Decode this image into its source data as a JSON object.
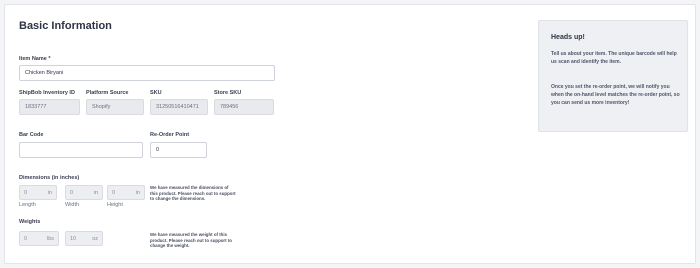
{
  "section_title": "Basic Information",
  "item_name": {
    "label": "Item Name *",
    "value": "Chicken Biryani"
  },
  "shipbob_id": {
    "label": "ShipBob Inventory ID",
    "value": "1833777"
  },
  "platform_source": {
    "label": "Platform Source",
    "value": "Shopify"
  },
  "sku": {
    "label": "SKU",
    "value": "31250516410471"
  },
  "store_sku": {
    "label": "Store SKU",
    "value": "789456"
  },
  "bar_code": {
    "label": "Bar Code",
    "value": ""
  },
  "reorder_point": {
    "label": "Re-Order Point",
    "value": "0"
  },
  "dimensions": {
    "label": "Dimensions (in inches)",
    "unit": "in",
    "length": {
      "label": "Length",
      "value": "0"
    },
    "width": {
      "label": "Width",
      "value": "0"
    },
    "height": {
      "label": "Height",
      "value": "0"
    },
    "note": "We have measured the dimensions of this product. Please reach out to support to change the dimensions."
  },
  "weights": {
    "label": "Weights",
    "lbs": {
      "value": "0",
      "unit": "lbs"
    },
    "oz": {
      "value": "10",
      "unit": "oz"
    },
    "note": "We have measured the weight of this product. Please reach out to support to change the weight."
  },
  "sidebar": {
    "title": "Heads up!",
    "p1": "Tell us about your item. The unique barcode will help us scan and identify the item.",
    "p2": "Once you set the re-order point, we will notify you when the on-hand level matches the re-order point, so you can send us more inventory!"
  }
}
